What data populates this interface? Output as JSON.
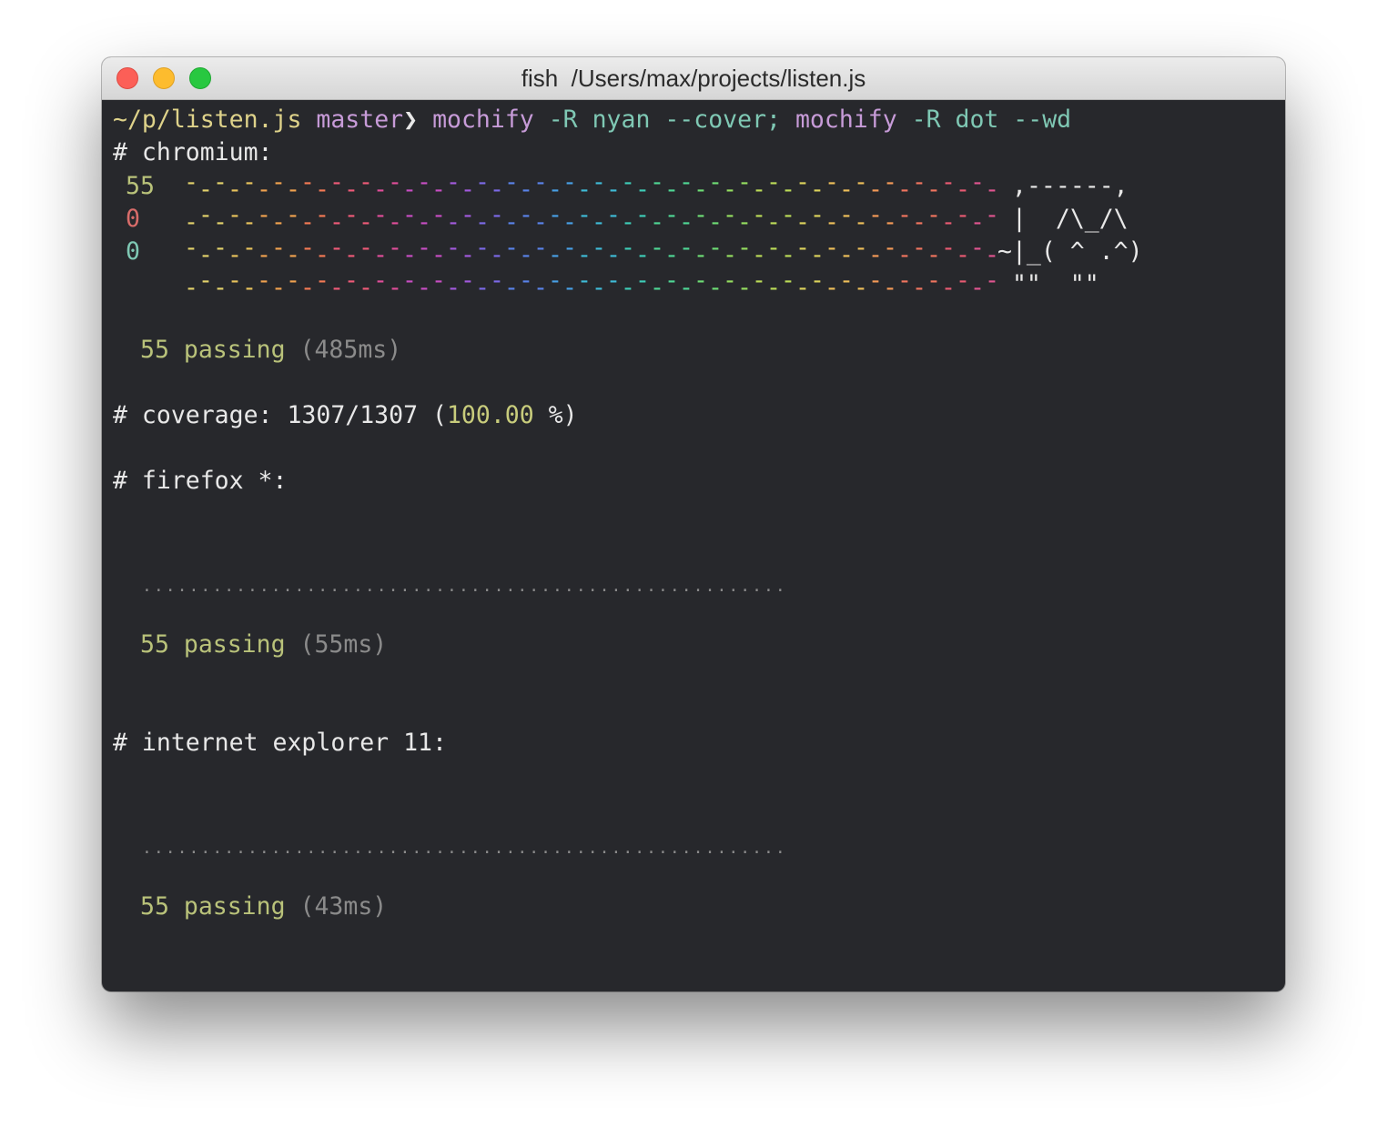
{
  "window": {
    "title": "fish  /Users/max/projects/listen.js"
  },
  "prompt": {
    "path": "~/p/listen.js",
    "branch": "master",
    "arrow": "❯",
    "cmd1_prog": "mochify",
    "cmd1_args": "-R nyan --cover;",
    "cmd2_prog": "mochify",
    "cmd2_args": "-R dot --wd"
  },
  "chromium": {
    "header": "# chromium:",
    "stats": [
      "55",
      "0",
      "0"
    ],
    "cat_lines": [
      ",------,",
      "|  /\\_/\\",
      "~|_( ^ .^)",
      " \"\"  \"\""
    ],
    "passing_count": "55 passing",
    "passing_time": "(485ms)"
  },
  "coverage": {
    "prefix": "# coverage: 1307/1307 (",
    "percent": "100.00",
    "suffix": " %)"
  },
  "firefox": {
    "header": "# firefox *:",
    "dots": ".......................................................",
    "passing_count": "55 passing",
    "passing_time": "(55ms)"
  },
  "ie": {
    "header": "# internet explorer 11:",
    "dots": ".......................................................",
    "passing_count": "55 passing",
    "passing_time": "(43ms)"
  },
  "colors": {
    "path": "#ded28a",
    "branch": "#c79bd8",
    "passing": "#b9c27a",
    "failing": "#d86c6a",
    "pending": "#7fc8b4",
    "rainbow": [
      "#e3d26b",
      "#e8c35c",
      "#f0a24f",
      "#f47a55",
      "#ef5a78",
      "#e04e9a",
      "#c84ec4",
      "#a35ade",
      "#7c6ae8",
      "#5a83ea",
      "#48a0e6",
      "#3fbcd8",
      "#3ecdb8",
      "#4fd795",
      "#6edd75",
      "#95de60",
      "#bcdc58",
      "#dcd35c",
      "#eebf5a",
      "#f49a57",
      "#f0755f",
      "#e85a72",
      "#e05590"
    ]
  }
}
